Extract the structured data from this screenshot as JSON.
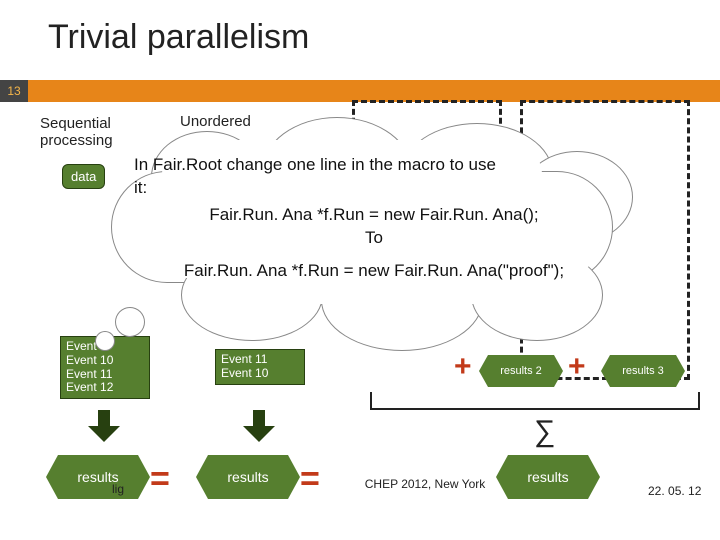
{
  "slide": {
    "title": "Trivial parallelism",
    "page_number": "13"
  },
  "labels": {
    "sequential": "Sequential\nprocessing",
    "unordered": "Unordered",
    "data_source": "data"
  },
  "events": {
    "col1": [
      "Event  9",
      "Event 10",
      "Event 11",
      "Event 12"
    ],
    "col2": [
      "Event 11",
      "Event 10"
    ]
  },
  "partial_results": {
    "r2": "results 2",
    "r3": "results 3"
  },
  "results_label": "results",
  "operators": {
    "plus": "+",
    "equals": "=",
    "sigma": "∑"
  },
  "cloud": {
    "line1": "In Fair.Root change one line in the macro to use",
    "line2": "it:",
    "line3": "Fair.Run. Ana *f.Run = new Fair.Run. Ana();",
    "line4": "To",
    "line5": "Fair.Run. Ana *f.Run = new Fair.Run. Ana(\"proof\");"
  },
  "footer": {
    "lig": "lig",
    "chep": "CHEP 2012, New York",
    "date": "22. 05. 12"
  }
}
